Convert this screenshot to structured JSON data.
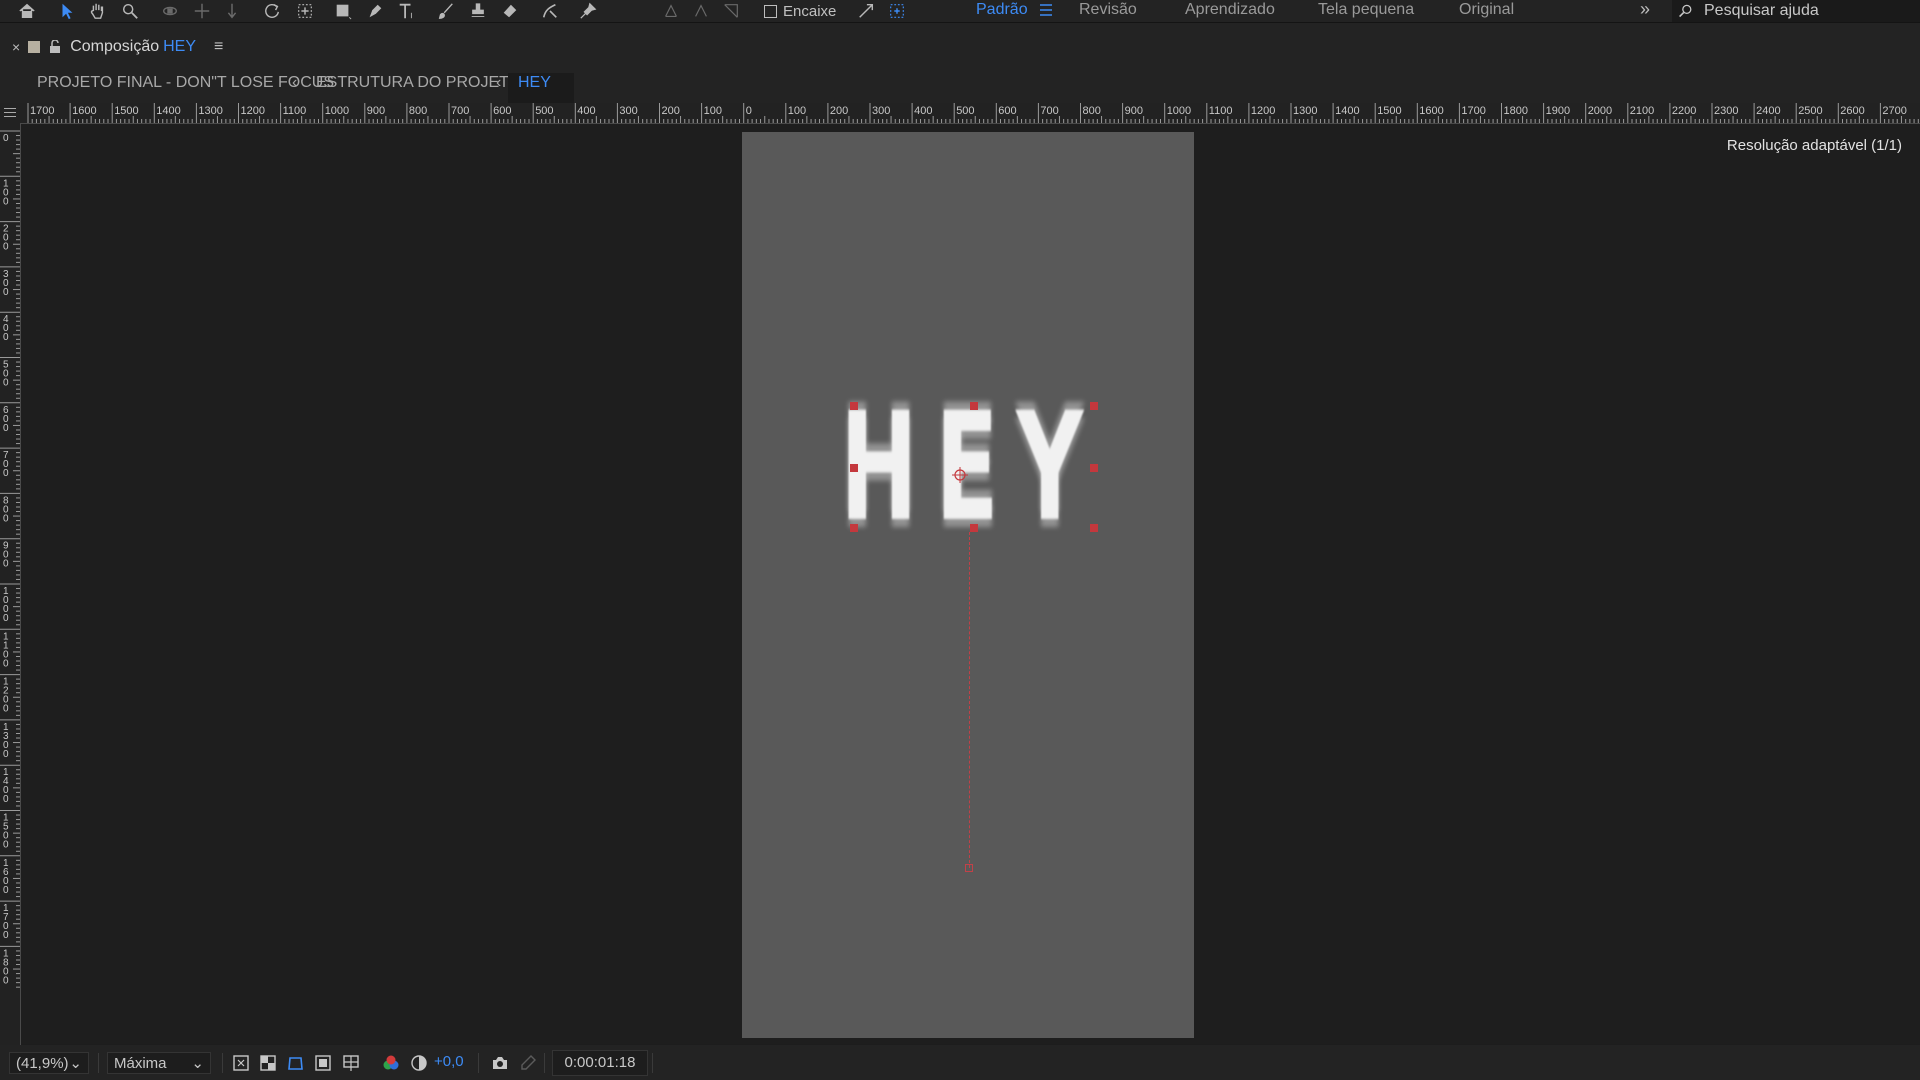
{
  "toolbar": {
    "tools": [
      {
        "name": "home-icon",
        "state": "normal"
      },
      {
        "name": "selection-tool-icon",
        "state": "active"
      },
      {
        "name": "hand-tool-icon",
        "state": "normal"
      },
      {
        "name": "zoom-tool-icon",
        "state": "normal"
      },
      {
        "name": "orbit-camera-icon",
        "state": "dim"
      },
      {
        "name": "pan-camera-icon",
        "state": "dim"
      },
      {
        "name": "dolly-camera-icon",
        "state": "dim"
      },
      {
        "name": "rotation-tool-icon",
        "state": "normal"
      },
      {
        "name": "pan-behind-tool-icon",
        "state": "normal"
      },
      {
        "name": "rectangle-tool-icon",
        "state": "normal"
      },
      {
        "name": "pen-tool-icon",
        "state": "normal"
      },
      {
        "name": "type-tool-icon",
        "state": "normal"
      },
      {
        "name": "brush-tool-icon",
        "state": "normal"
      },
      {
        "name": "clone-stamp-icon",
        "state": "normal"
      },
      {
        "name": "eraser-tool-icon",
        "state": "normal"
      },
      {
        "name": "roto-brush-icon",
        "state": "normal"
      },
      {
        "name": "puppet-pin-icon",
        "state": "normal"
      }
    ],
    "snapping_label": "Encaixe",
    "workspaces": [
      "Padrão",
      "Revisão",
      "Aprendizado",
      "Tela pequena",
      "Original"
    ],
    "active_workspace": "Padrão",
    "overflow_glyph": "»",
    "search_placeholder": "Pesquisar ajuda"
  },
  "panel": {
    "close_glyph": "×",
    "title_prefix": "Composição",
    "comp_name": "HEY",
    "menu_glyph": "≡",
    "label_color": "#b7b0a1"
  },
  "breadcrumbs": {
    "items": [
      "PROJETO FINAL - DON\"T LOSE FOCUS",
      "ESTRUTURA DO PROJETO",
      "HEY"
    ],
    "separator": "‹"
  },
  "ruler": {
    "h_labels": [
      "1700",
      "1600",
      "1500",
      "1400",
      "1300",
      "1200",
      "1100",
      "1000",
      "900",
      "800",
      "700",
      "600",
      "500",
      "400",
      "300",
      "200",
      "100",
      "0",
      "100",
      "200",
      "300",
      "400",
      "500",
      "600",
      "700",
      "800",
      "900",
      "1000",
      "1100",
      "1200",
      "1300",
      "1400",
      "1500",
      "1600",
      "1700",
      "1800",
      "1900",
      "2000",
      "2100",
      "2200",
      "2300",
      "2400",
      "2500",
      "2600",
      "2700"
    ],
    "v_labels": [
      "0",
      "100",
      "200",
      "300",
      "400",
      "500",
      "600",
      "700",
      "800",
      "900",
      "1000",
      "1100",
      "1200",
      "1300",
      "1400",
      "1500",
      "1600",
      "1700",
      "1800"
    ]
  },
  "viewer": {
    "resolution_label": "Resolução adaptável (1/1)",
    "canvas_color": "#595959",
    "text_layer": "HEY",
    "handle_color": "#c4383d"
  },
  "bottom": {
    "zoom": "(41,9%)",
    "quality": "Máxima",
    "exposure": "+0,0",
    "timecode": "0:00:01:18"
  }
}
